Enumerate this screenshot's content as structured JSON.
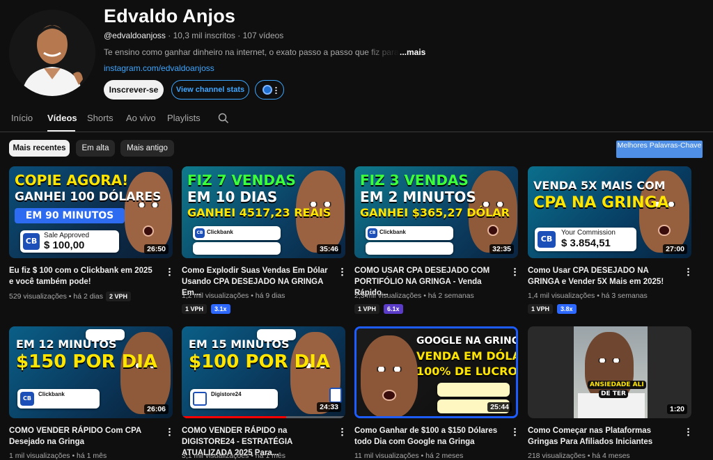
{
  "channel": {
    "name": "Edvaldo Anjos",
    "handle": "@edvaldoanjoss",
    "stats": " · 10,3 mil inscritos · 107 vídeos",
    "description": "Te ensino como ganhar dinheiro na internet, o exato passo a passo que fiz para vender todos os dias",
    "more": "...mais",
    "link": "instagram.com/edvaldoanjoss",
    "subscribe_label": "Inscrever-se",
    "stats_button_label": "View channel stats"
  },
  "tabs": [
    "Início",
    "Vídeos",
    "Shorts",
    "Ao vivo",
    "Playlists"
  ],
  "chips": [
    "Mais recentes",
    "Em alta",
    "Mais antigo"
  ],
  "keywords_button": "Melhores Palavras-Chave",
  "videos": [
    {
      "thumb": {
        "l1": "COPIE AGORA!",
        "l2": "GANHEI 100 DÓLARES",
        "l3": "EM 90 MINUTOS",
        "box_label": "Sale Approved",
        "box_amount": "$ 100,00",
        "logo": "CB"
      },
      "duration": "26:50",
      "title": "Eu fiz $ 100 com o Clickbank em 2025 e você também pode!",
      "meta": "529 visualizações • há 2 dias",
      "badge1": "2 VPH"
    },
    {
      "thumb": {
        "l1": "FIZ 7 VENDAS",
        "l2": "EM 10 DIAS",
        "l3": "GANHEI 4517,23 REAIS",
        "box_label": "Clickbank",
        "logo": "CB"
      },
      "duration": "35:46",
      "title": "Como Explodir Suas Vendas Em Dólar Usando CPA DESEJADO NA GRINGA Em...",
      "meta": "1,2 mil visualizações • há 9 dias",
      "badge1": "1 VPH",
      "badge2": "3.1x"
    },
    {
      "thumb": {
        "l1": "FIZ 3 VENDAS",
        "l2": "EM 2 MINUTOS",
        "l3": "GANHEI $365,27 DÓLAR",
        "box_label": "Clickbank",
        "logo": "CB"
      },
      "duration": "32:35",
      "title": "COMO USAR CPA DESEJADO COM PORTIFÓLIO NA GRINGA - Venda Rápido...",
      "meta": "2,3 mil visualizações • há 2 semanas",
      "badge1": "1 VPH",
      "badge2": "6.1x"
    },
    {
      "thumb": {
        "l1": "VENDA 5X MAIS COM",
        "l2": "CPA NA GRINGA",
        "box_label": "Your Commission",
        "box_amount": "$ 3.854,51",
        "logo": "CB"
      },
      "duration": "27:00",
      "title": "Como Usar CPA DESEJADO NA GRINGA e Vender 5X Mais em 2025!",
      "meta": "1,4 mil visualizações • há 3 semanas",
      "badge1": "1 VPH",
      "badge2": "3.8x"
    },
    {
      "thumb": {
        "l1": "EM 12 MINUTOS",
        "l2": "$150 POR DIA",
        "box_label": "Clickbank",
        "logo": "CB"
      },
      "duration": "26:06",
      "title": "COMO VENDER RÁPIDO Com CPA Desejado na Gringa",
      "meta": "1 mil visualizações • há 1 mês"
    },
    {
      "thumb": {
        "l1": "EM 15 MINUTOS",
        "l2": "$100 POR DIA",
        "box_label": "Digistore24"
      },
      "duration": "24:33",
      "title": "COMO VENDER RÁPIDO na DIGISTORE24 - ESTRATÉGIA ATUALIZADA 2025 Para...",
      "meta": "3,1 mil visualizações • há 1 mês"
    },
    {
      "thumb": {
        "l1": "GOOGLE NA GRINGA",
        "l2": "VENDA EM DÓLAR",
        "l3": "100% DE LUCRO"
      },
      "duration": "25:44",
      "title": "Como Ganhar de $100 a $150 Dólares todo Dia com Google na Gringa",
      "meta": "11 mil visualizações • há 2 meses"
    },
    {
      "thumb": {
        "l1": "ANSIEDADE ALI",
        "l2": "DE TER"
      },
      "duration": "1:20",
      "title": "Como Começar nas Plataformas Gringas Para Afiliados Iniciantes",
      "meta": "218 visualizações • há 4 meses"
    }
  ],
  "colors": {
    "accent": "#3ea6ff",
    "progress": "#ff0000",
    "keywords_button": "#4f8fe6"
  }
}
